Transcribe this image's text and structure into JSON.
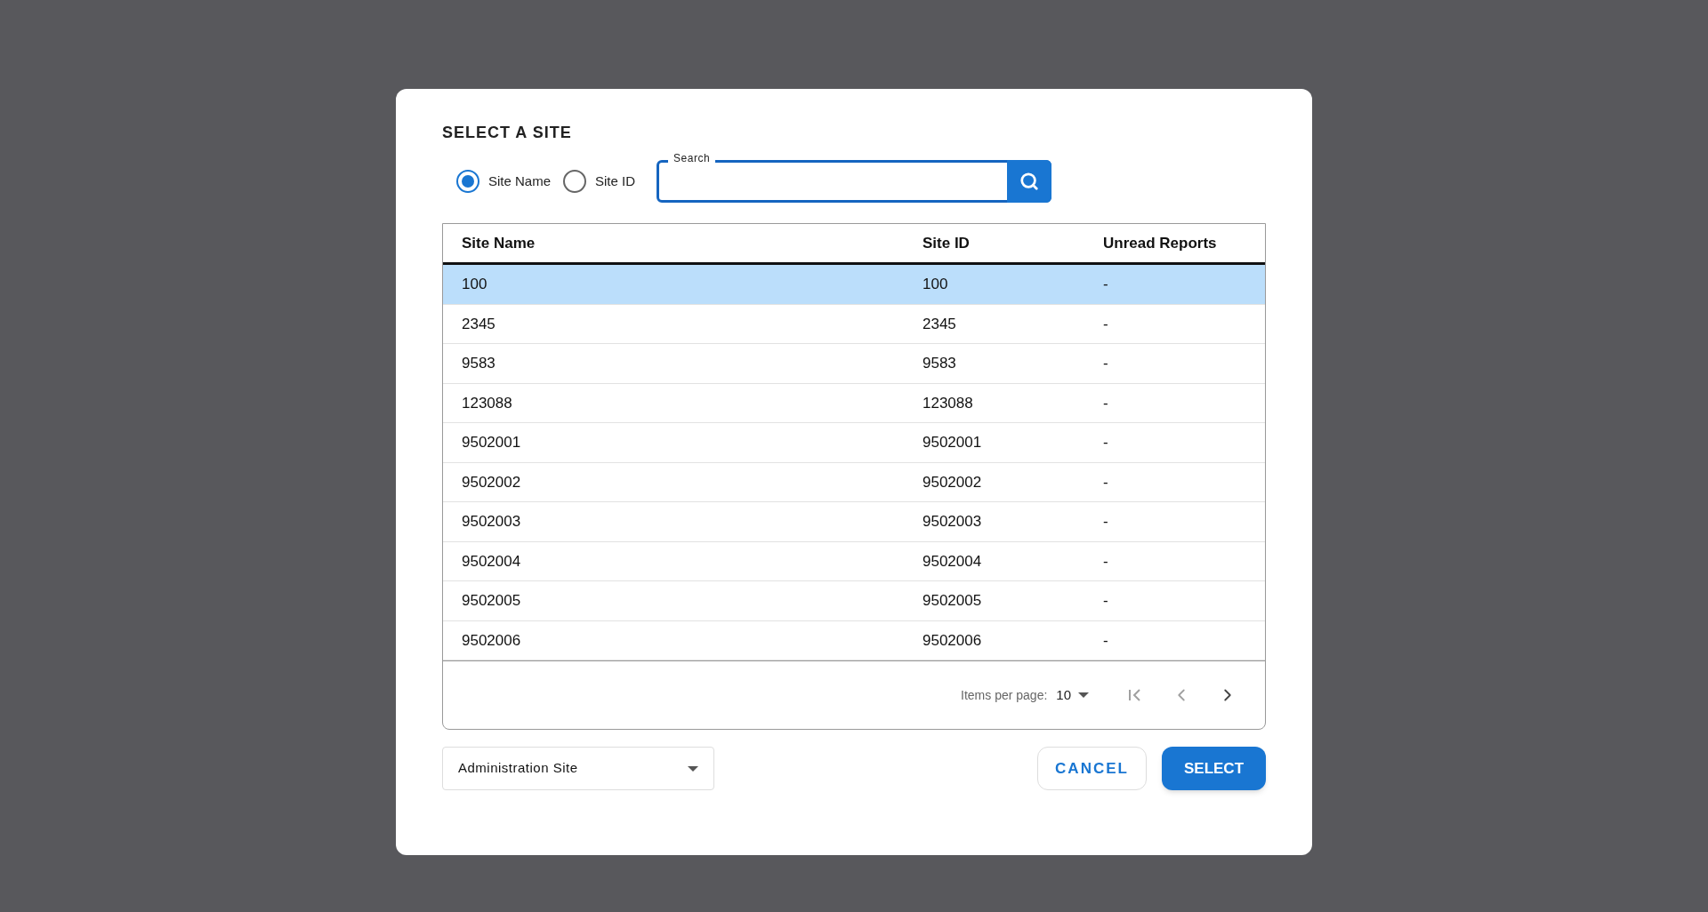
{
  "dialog": {
    "title": "SELECT A SITE"
  },
  "search_by": [
    {
      "label": "Site Name",
      "selected": true
    },
    {
      "label": "Site ID",
      "selected": false
    }
  ],
  "search": {
    "label": "Search",
    "focused": true
  },
  "table": {
    "columns": [
      "Site Name",
      "Site ID",
      "Unread Reports"
    ],
    "rows": [
      {
        "cells": [
          "100",
          "100",
          "-"
        ],
        "selected": true
      },
      {
        "cells": [
          "2345",
          "2345",
          "-"
        ],
        "selected": false
      },
      {
        "cells": [
          "9583",
          "9583",
          "-"
        ],
        "selected": false
      },
      {
        "cells": [
          "123088",
          "123088",
          "-"
        ],
        "selected": false
      },
      {
        "cells": [
          "9502001",
          "9502001",
          "-"
        ],
        "selected": false
      },
      {
        "cells": [
          "9502002",
          "9502002",
          "-"
        ],
        "selected": false
      },
      {
        "cells": [
          "9502003",
          "9502003",
          "-"
        ],
        "selected": false
      },
      {
        "cells": [
          "9502004",
          "9502004",
          "-"
        ],
        "selected": false
      },
      {
        "cells": [
          "9502005",
          "9502005",
          "-"
        ],
        "selected": false
      },
      {
        "cells": [
          "9502006",
          "9502006",
          "-"
        ],
        "selected": false
      }
    ]
  },
  "paginator": {
    "items_per_page_label": "Items per page:",
    "page_size": "10",
    "first_disabled": true,
    "previous_disabled": true,
    "next_disabled": false
  },
  "site_type": {
    "value": "Administration Site"
  },
  "buttons": [
    {
      "label": "CANCEL",
      "kind": "outlined"
    },
    {
      "label": "SELECT",
      "kind": "primary"
    }
  ]
}
